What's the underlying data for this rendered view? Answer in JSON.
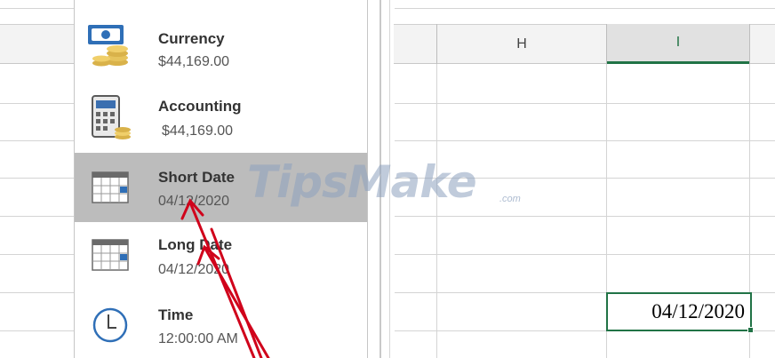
{
  "format_menu": {
    "items": [
      {
        "name": "Currency",
        "sample": "$44,169.00",
        "icon": "currency-icon",
        "selected": false
      },
      {
        "name": "Accounting",
        "sample": "$44,169.00",
        "icon": "accounting-icon",
        "selected": false
      },
      {
        "name": "Short Date",
        "sample": "04/12/2020",
        "icon": "calendar-icon",
        "selected": true
      },
      {
        "name": "Long Date",
        "sample": "04/12/2020",
        "icon": "calendar-icon",
        "selected": false
      },
      {
        "name": "Time",
        "sample": "12:00:00 AM",
        "icon": "clock-icon",
        "selected": false
      }
    ]
  },
  "grid": {
    "column_headers": [
      "H",
      "I"
    ],
    "active_cell_value": "04/12/2020"
  },
  "watermark": {
    "text": "TipsMake",
    "suffix": ".com"
  },
  "colors": {
    "excel_green": "#217346",
    "selected_item_bg": "#bcbcbc",
    "annotation_arrow": "#d0021b"
  }
}
